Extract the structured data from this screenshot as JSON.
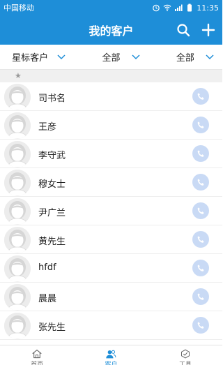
{
  "status_bar": {
    "carrier": "中国移动",
    "time": "11:35"
  },
  "header": {
    "title": "我的客户"
  },
  "filters": [
    {
      "label": "星标客户"
    },
    {
      "label": "全部"
    },
    {
      "label": "全部"
    }
  ],
  "section_header": "★",
  "contacts": [
    {
      "name": "司书名"
    },
    {
      "name": "王彦"
    },
    {
      "name": "李守武"
    },
    {
      "name": "穆女士"
    },
    {
      "name": "尹广兰"
    },
    {
      "name": "黄先生"
    },
    {
      "name": "hfdf"
    },
    {
      "name": "晨晨"
    },
    {
      "name": "张先生"
    }
  ],
  "tabs": [
    {
      "label": "首页",
      "icon": "home-icon",
      "active": false
    },
    {
      "label": "客户",
      "icon": "customers-icon",
      "active": true
    },
    {
      "label": "工具",
      "icon": "tools-icon",
      "active": false
    }
  ],
  "colors": {
    "primary": "#1e8ed8",
    "call_button": "#c9daf5",
    "avatar_bg": "#e9e9e9"
  }
}
